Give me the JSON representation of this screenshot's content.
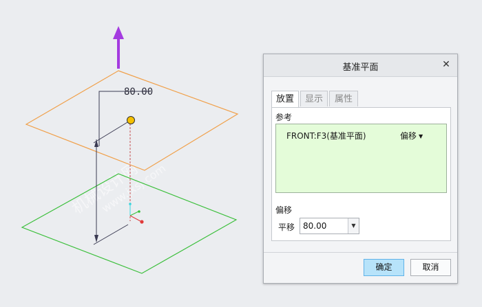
{
  "viewport": {
    "dimension_value": "80.00",
    "watermark_text": "机械设计网",
    "watermark_url": "www.jxsj.com",
    "colors": {
      "background": "#ebedf0",
      "offset_plane": "#f0a04a",
      "reference_plane": "#3bbf3b",
      "direction_arrow": "#a43be0",
      "handle": "#f5c000",
      "dimension": "#3a3a52"
    }
  },
  "dialog": {
    "title": "基准平面",
    "close_icon": "close-icon",
    "tabs": [
      {
        "label": "放置",
        "active": true
      },
      {
        "label": "显示",
        "active": false
      },
      {
        "label": "属性",
        "active": false
      }
    ],
    "references_label": "参考",
    "reference": {
      "name": "FRONT:F3(基准平面)",
      "type": "偏移"
    },
    "offset_label": "偏移",
    "translate_label": "平移",
    "translate_value": "80.00",
    "ok_label": "确定",
    "cancel_label": "取消"
  }
}
